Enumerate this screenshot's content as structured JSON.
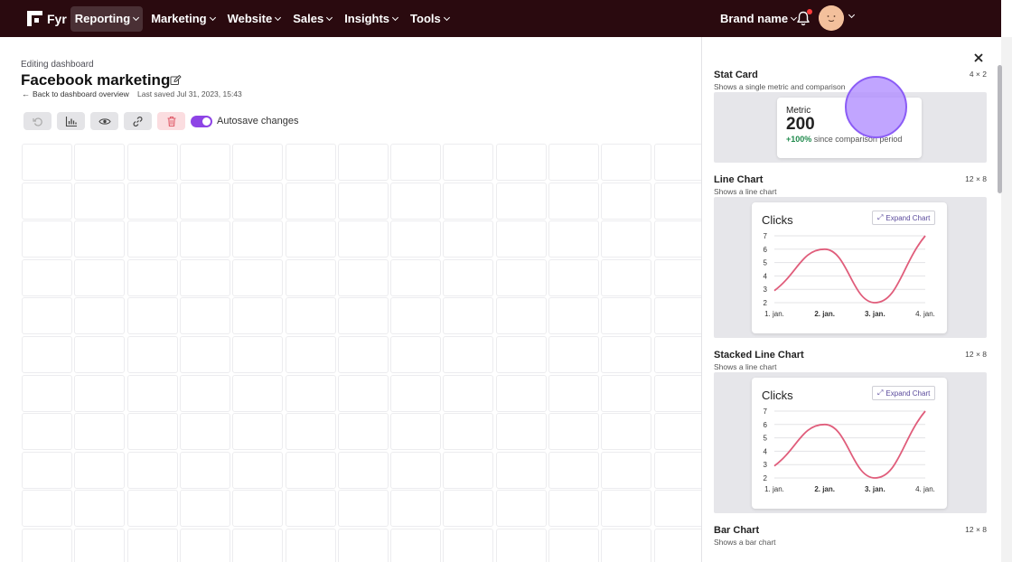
{
  "nav": {
    "logo": "Fyr",
    "items": [
      {
        "label": "Reporting",
        "active": true
      },
      {
        "label": "Marketing",
        "active": false
      },
      {
        "label": "Website",
        "active": false
      },
      {
        "label": "Sales",
        "active": false
      },
      {
        "label": "Insights",
        "active": false
      },
      {
        "label": "Tools",
        "active": false
      }
    ],
    "brand": "Brand name"
  },
  "editor": {
    "editing_label": "Editing dashboard",
    "title": "Facebook marketing",
    "back_link": "Back to dashboard overview",
    "last_saved": "Last saved Jul 31, 2023, 15:43",
    "autosave_label": "Autosave changes",
    "autosave_on": true
  },
  "drawer": {
    "widgets": [
      {
        "id": "stat",
        "title": "Stat Card",
        "subtitle": "Shows a single metric and comparison",
        "size": "4 × 2"
      },
      {
        "id": "line",
        "title": "Line Chart",
        "subtitle": "Shows a line chart",
        "size": "12 × 8"
      },
      {
        "id": "stacked",
        "title": "Stacked Line Chart",
        "subtitle": "Shows a line chart",
        "size": "12 × 8"
      },
      {
        "id": "bar",
        "title": "Bar Chart",
        "subtitle": "Shows a bar chart",
        "size": "12 × 8"
      }
    ],
    "stat_card": {
      "metric": "Metric",
      "value": "200",
      "change": "+100%",
      "comparison": "since comparison period"
    },
    "expand_label": "Expand Chart"
  },
  "colors": {
    "nav_bg": "#2a0a0f",
    "accent": "#8e44e6",
    "line": "#e05d7b",
    "positive": "#1f8a4c"
  },
  "chart_data": [
    {
      "type": "line",
      "title": "Clicks",
      "categories": [
        "1. jan.",
        "2. jan.",
        "3. jan.",
        "4. jan."
      ],
      "values": [
        2.9,
        6.0,
        2.0,
        7.0
      ],
      "ylim": [
        2,
        7
      ],
      "yticks": [
        2,
        3,
        4,
        5,
        6,
        7
      ],
      "grid": true
    },
    {
      "type": "line",
      "title": "Clicks",
      "categories": [
        "1. jan.",
        "2. jan.",
        "3. jan.",
        "4. jan."
      ],
      "values": [
        2.9,
        6.0,
        2.0,
        7.0
      ],
      "ylim": [
        2,
        7
      ],
      "yticks": [
        2,
        3,
        4,
        5,
        6,
        7
      ],
      "grid": true
    }
  ]
}
